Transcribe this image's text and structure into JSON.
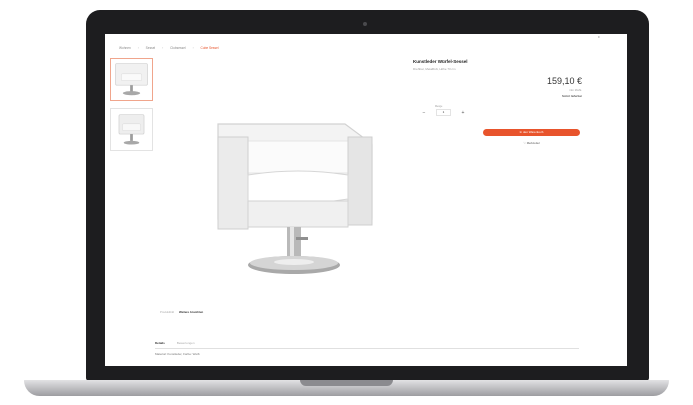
{
  "screen": {
    "menu_label": "≡",
    "breadcrumb": [
      "Wohnen",
      "Sessel",
      "Clubsessel",
      "Cube Sessel"
    ],
    "product": {
      "title": "Kunstleder Würfel-Sessel",
      "subtitle": "Drehbar, Metallfuß, Höhe 73 cm",
      "price": "159,10 €",
      "price_note": "inkl. MwSt.",
      "stock": "Sofort lieferbar"
    },
    "quantity": {
      "label": "Menge",
      "value": "1",
      "minus": "−",
      "plus": "+"
    },
    "cart_button": "In den Warenkorb",
    "wish_link": "♡ Merkzettel",
    "gallery_nav": [
      "Produktbild",
      "Weitere Ansichten"
    ],
    "tabs": [
      "Details",
      "Bewertungen"
    ],
    "tab_content": "Material: Kunstleder, Farbe: Weiß"
  }
}
